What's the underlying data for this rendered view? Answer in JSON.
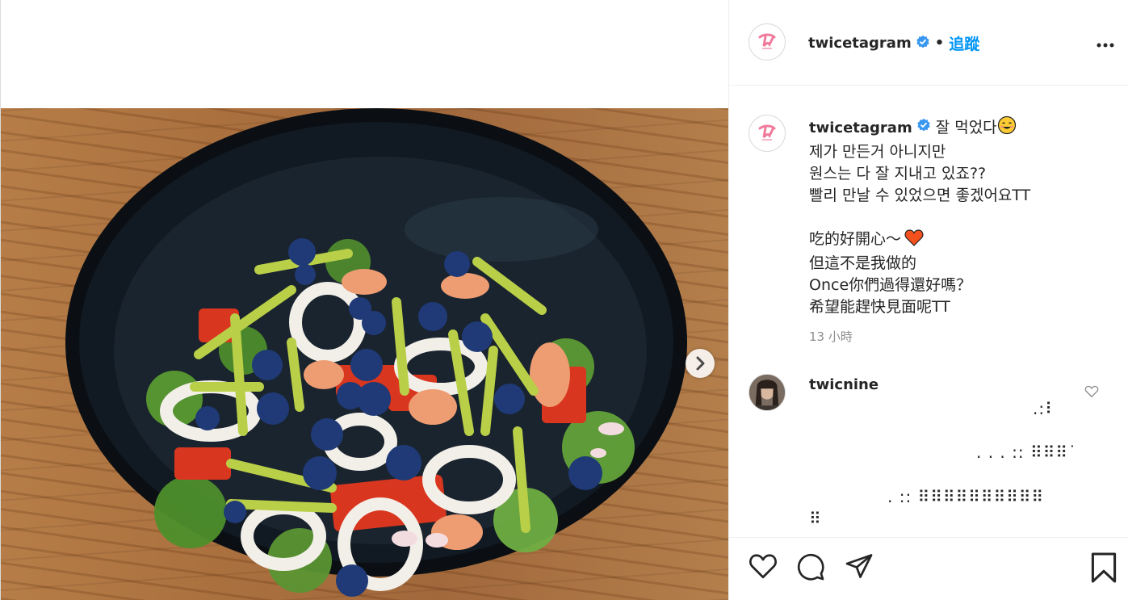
{
  "post": {
    "username": "twicetagram",
    "follow_label": "追蹤",
    "dot": "•",
    "caption_lines": [
      "잘 먹었다",
      "제가 만든거 아니지만",
      "원스는 다 잘 지내고 있죠??",
      "빨리 만날 수 있었으면 좋겠어요TT",
      "",
      "吃的好開心～",
      "但這不是我做的",
      "Once你們過得還好嗎？",
      "希望能趕快見面呢TT"
    ],
    "timestamp": "13 小時"
  },
  "comment": {
    "username": "twicnine",
    "lines": [
      ".:⠇",
      ". . . :: ⠿⠿⠿˙",
      ". :: ⠿⠿⠿⠿⠿⠿⠿⠿⠿⠿",
      "⠿"
    ]
  },
  "colors": {
    "accent": "#0095f6",
    "verified": "#3897f0",
    "heart_emoji": "#f4511e",
    "twice_logo": "#f17a9b"
  },
  "icons": {
    "verified": "verified-badge-icon",
    "more": "more-options-icon",
    "next": "chevron-right-icon",
    "like": "heart-outline-icon",
    "comment": "comment-bubble-icon",
    "share": "paper-plane-icon",
    "save": "bookmark-icon"
  }
}
